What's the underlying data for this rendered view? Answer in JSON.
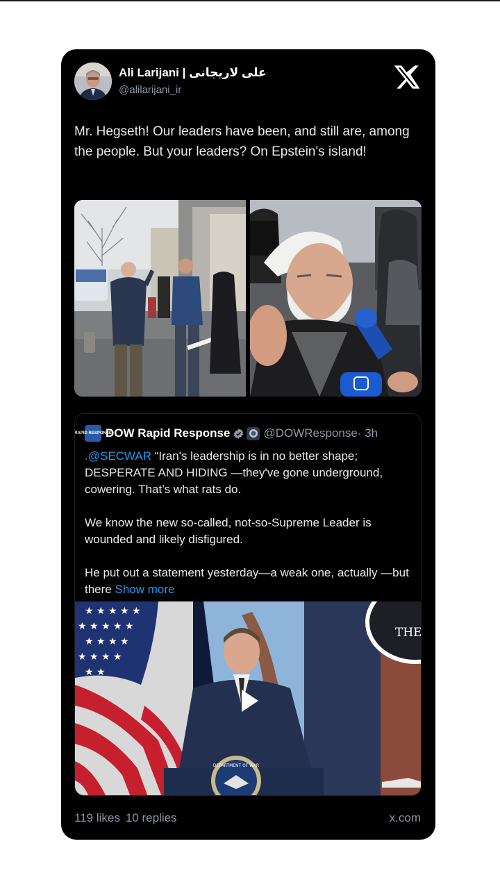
{
  "author": {
    "name": "Ali Larijani | علی لاریجانی",
    "handle": "@alilarijani_ir",
    "avatar_icon": "portrait-avatar"
  },
  "platform_icon": "x-logo-icon",
  "tweet": {
    "text": "Mr. Hegseth! Our leaders have been, and still are, among the people. But your leaders? On Epstein's island!",
    "media": [
      {
        "icon": "street-crowd-photo"
      },
      {
        "icon": "cleric-interview-photo"
      }
    ]
  },
  "quote": {
    "avatar_text": "RAPID RESPONSE",
    "name": "DOW Rapid Response",
    "handle": "@DOWResponse",
    "time": "· 3h",
    "mention": ".@SECWAR",
    "line1_rest": " “Iran's leadership is in no better shape; DESPERATE AND HIDING —they've gone underground, cowering. That’s what rats do.",
    "para2": "We know the new so-called, not-so-Supreme Leader is wounded and likely disfigured.",
    "para3": "He put out a statement yesterday—a weak one, actually —but there ",
    "show_more": "Show more",
    "video": {
      "seal_text": "THE",
      "podium_text": "DEPARTMENT OF WAR",
      "play_icon": "play-icon"
    }
  },
  "footer": {
    "likes": "119 likes",
    "replies": "10 replies",
    "site": "x.com"
  },
  "colors": {
    "card_bg": "#000000",
    "link": "#1d9bf0",
    "muted": "#8b98a5"
  }
}
